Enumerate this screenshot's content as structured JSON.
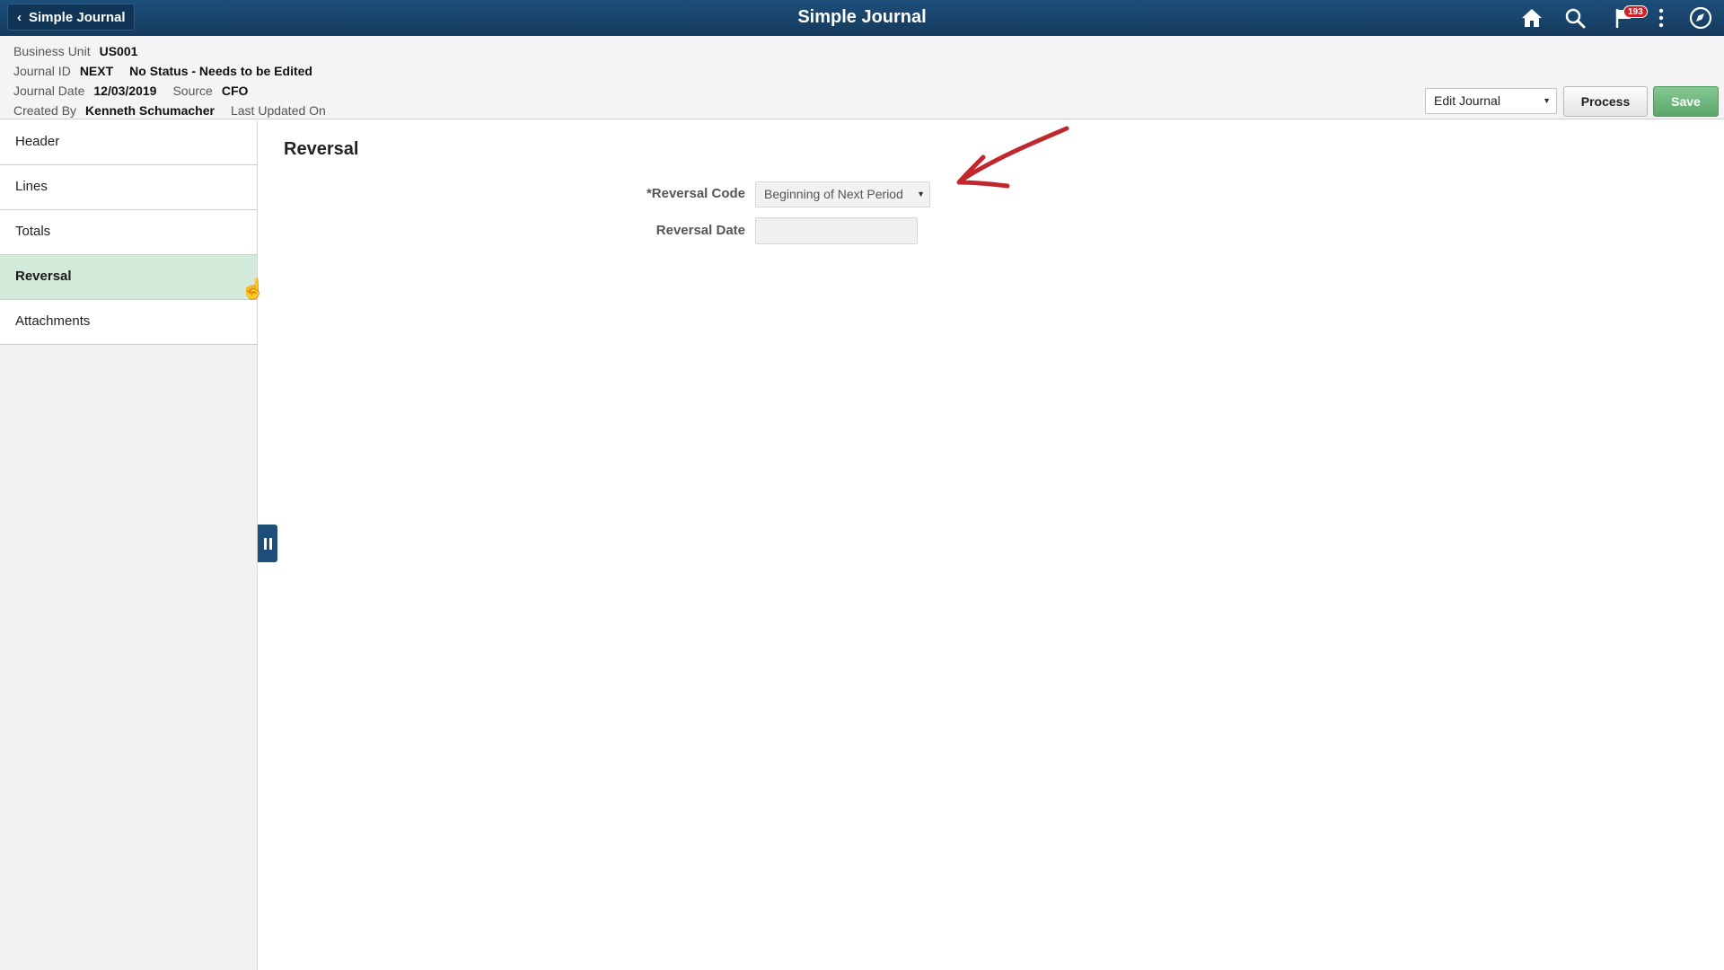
{
  "banner": {
    "back_label": "Simple Journal",
    "title": "Simple Journal",
    "notification_count": "193",
    "icons": [
      "home-icon",
      "search-icon",
      "flag-icon",
      "more-menu-icon",
      "navbar-icon"
    ]
  },
  "summary": {
    "business_unit_label": "Business Unit",
    "business_unit": "US001",
    "journal_id_label": "Journal ID",
    "journal_id": "NEXT",
    "status": "No Status - Needs to be Edited",
    "journal_date_label": "Journal Date",
    "journal_date": "12/03/2019",
    "source_label": "Source",
    "source": "CFO",
    "created_by_label": "Created By",
    "created_by": "Kenneth Schumacher",
    "last_updated_label": "Last Updated On"
  },
  "actions": {
    "select_value": "Edit Journal",
    "process_label": "Process",
    "save_label": "Save"
  },
  "sidebar": {
    "items": [
      {
        "label": "Header"
      },
      {
        "label": "Lines"
      },
      {
        "label": "Totals"
      },
      {
        "label": "Reversal",
        "active": true
      },
      {
        "label": "Attachments"
      }
    ]
  },
  "main": {
    "title": "Reversal",
    "reversal_code_label": "*Reversal Code",
    "reversal_code_value": "Beginning of Next Period",
    "reversal_date_label": "Reversal Date",
    "reversal_date_value": ""
  },
  "colors": {
    "banner": "#1d4e7a",
    "active_item": "#d4ebdc",
    "save_button": "#5aa869",
    "annotation": "#c0282d",
    "badge": "#d51f27"
  }
}
